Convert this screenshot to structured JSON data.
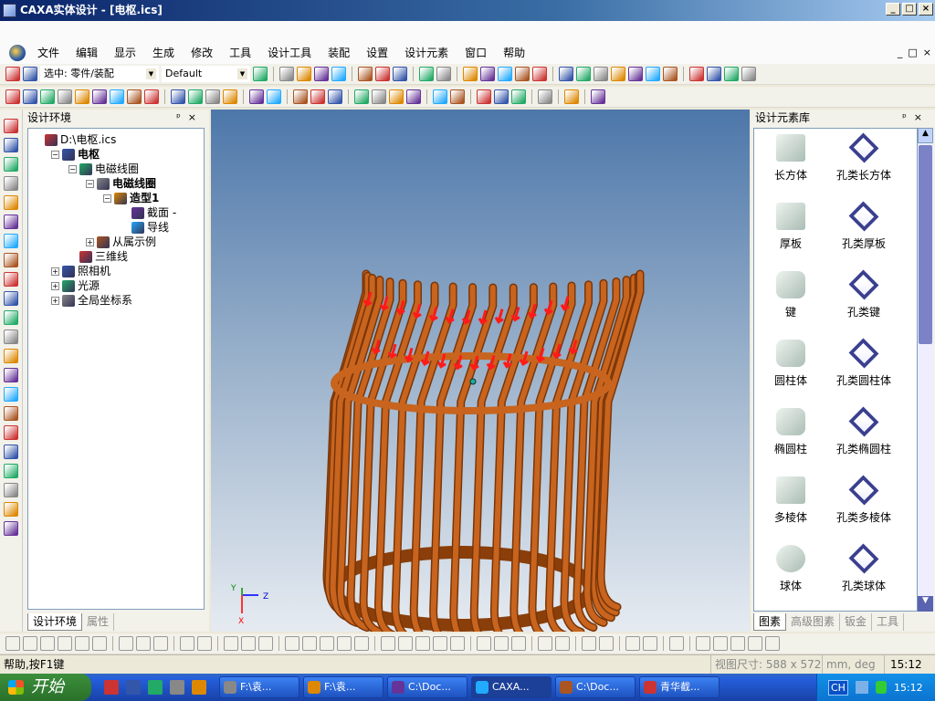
{
  "window": {
    "title": "CAXA实体设计 - [电枢.ics]",
    "minimize": "_",
    "maximize": "□",
    "close": "×"
  },
  "menu": [
    "文件",
    "编辑",
    "显示",
    "生成",
    "修改",
    "工具",
    "设计工具",
    "装配",
    "设置",
    "设计元素",
    "窗口",
    "帮助"
  ],
  "toolbar1": {
    "select_combo": "选中: 零件/装配",
    "style_combo": "Default",
    "icons": [
      "select-arrow-icon",
      "select-filter-icon",
      "assembly-tree-icon",
      "wireframe-box-icon",
      "wireframe-blue-icon",
      "smooth-shading-icon",
      "smooth-edge-shading-icon",
      "transparent-box-icon",
      "shaded-gray-icon",
      "shaded-gray2-icon",
      "properties-icon",
      "warning-icon",
      "extrude-icon",
      "revolve-icon",
      "sweep-icon",
      "loft-icon",
      "shell-icon",
      "fillet-icon",
      "chamfer-icon",
      "draft-icon",
      "split-icon",
      "mirror-icon",
      "pattern-icon",
      "boolean-icon",
      "red-cube-icon",
      "red-cube2-icon",
      "red-cube3-icon",
      "red-cube4-icon"
    ]
  },
  "toolbar2": {
    "icons": [
      "curve-arrow-icon",
      "sketch-icon",
      "plane-icon",
      "offset-plane-icon",
      "formula-icon",
      "constraint-icon",
      "trim-icon",
      "extend-icon",
      "surface-icon",
      "extrude-up-icon",
      "rotate-icon",
      "sweep-tool-icon",
      "mouse-icon",
      "text-icon",
      "render-icon",
      "light-icon",
      "material-icon",
      "toolbox-icon",
      "new-doc-icon",
      "new-drawing-icon",
      "open-folder-icon",
      "save-icon",
      "undo-icon",
      "redo-icon",
      "copy-icon",
      "paste-icon",
      "cut-icon",
      "tree-view-icon",
      "green-arrow-icon",
      "help-pointer-icon"
    ]
  },
  "left_tools": [
    "move-icon",
    "rotate-view-icon",
    "pan-icon",
    "walk-icon",
    "zoom-icon",
    "zoom-window-icon",
    "zoom-fit-icon",
    "target-icon",
    "insert-icon",
    "camera-icon",
    "camera2-icon",
    "camera3-icon",
    "eraser-icon",
    "view-front-icon",
    "view-side-icon",
    "view-top-icon",
    "view-iso-icon",
    "view-shaded-icon",
    "sphere-icon",
    "dimension-icon",
    "eyedropper-icon",
    "pen-icon"
  ],
  "design_env": {
    "title": "设计环境",
    "pin": "ᵖ",
    "close": "×",
    "tree": [
      {
        "label": "D:\\电枢.ics",
        "level": 0,
        "toggle": "",
        "bold": false,
        "icon": "design-file-icon"
      },
      {
        "label": "电枢",
        "level": 1,
        "toggle": "−",
        "bold": true,
        "icon": "design-icon"
      },
      {
        "label": "电磁线圈",
        "level": 2,
        "toggle": "−",
        "bold": false,
        "icon": "assembly-icon"
      },
      {
        "label": "电磁线圈",
        "level": 3,
        "toggle": "−",
        "bold": true,
        "icon": "part-icon"
      },
      {
        "label": "造型1",
        "level": 4,
        "toggle": "−",
        "bold": true,
        "icon": "feature-block-icon"
      },
      {
        "label": "截面 -",
        "level": 5,
        "toggle": "",
        "bold": false,
        "icon": "section-icon"
      },
      {
        "label": "导线",
        "level": 5,
        "toggle": "",
        "bold": false,
        "icon": "guide-curve-icon"
      },
      {
        "label": "从属示例",
        "level": 3,
        "toggle": "+",
        "bold": false,
        "icon": "instance-icon"
      },
      {
        "label": "三维线",
        "level": 2,
        "toggle": "",
        "bold": false,
        "icon": "3d-curve-icon"
      },
      {
        "label": "照相机",
        "level": 1,
        "toggle": "+",
        "bold": false,
        "icon": "camera-icon"
      },
      {
        "label": "光源",
        "level": 1,
        "toggle": "+",
        "bold": false,
        "icon": "light-source-icon"
      },
      {
        "label": "全局坐标系",
        "level": 1,
        "toggle": "+",
        "bold": false,
        "icon": "global-coords-icon"
      }
    ],
    "tabs": [
      {
        "label": "设计环境",
        "active": true
      },
      {
        "label": "属性",
        "active": false
      }
    ]
  },
  "viewport": {
    "axes": {
      "x": "X",
      "y": "Y",
      "z": "Z"
    },
    "model_color": "#c8641e",
    "arrow_color": "#ff1a1a"
  },
  "library": {
    "title": "设计元素库",
    "pin": "ᵖ",
    "close": "×",
    "items": [
      "长方体",
      "孔类长方体",
      "厚板",
      "孔类厚板",
      "键",
      "孔类键",
      "圆柱体",
      "孔类圆柱体",
      "椭圆柱",
      "孔类椭圆柱",
      "多棱体",
      "孔类多棱体",
      "球体",
      "孔类球体"
    ],
    "tabs": [
      {
        "label": "图素",
        "active": true
      },
      {
        "label": "高级图素",
        "active": false
      },
      {
        "label": "钣金",
        "active": false
      },
      {
        "label": "工具",
        "active": false
      }
    ]
  },
  "bottom_toolbar": {
    "icons": [
      "project-icon",
      "scale-icon",
      "circle-arc-icon",
      "hatch-icon",
      "offset-icon",
      "stamp-icon",
      "delete-x-icon",
      "extend-line-icon",
      "trim-x-icon",
      "fillet-curve-icon",
      "chamfer-curve-icon",
      "line-icon",
      "angle-line-icon",
      "tangent-line-icon",
      "constraint-dim-icon",
      "circle-pair-icon",
      "rectangle-icon",
      "diamond-icon",
      "hexagon-icon",
      "circle-center-icon",
      "circle-2pt-icon",
      "circle-3pt-icon",
      "circle-tangent-icon",
      "circle-tangent2-icon",
      "arc-icon",
      "arc2-icon",
      "arc3-icon",
      "ellipse-icon",
      "spiral-icon",
      "spline-icon",
      "spline2-icon",
      "corner-icon",
      "corner2-icon",
      "text-block-icon",
      "perpendicular-icon",
      "parallel-icon",
      "equal-icon",
      "horizontal-icon",
      "vertical-icon"
    ]
  },
  "status": {
    "help": "帮助,按F1键",
    "view_size": "视图尺寸: 588 x 572",
    "units": "mm, deg",
    "time": "15:12"
  },
  "taskbar": {
    "start": "开始",
    "quicklaunch": [
      "qq-icon",
      "shield-app-icon",
      "browser-icon",
      "folder-app-icon",
      "paint-icon"
    ],
    "tasks": [
      {
        "label": "F:\\袁...",
        "icon": "folder-icon",
        "active": false
      },
      {
        "label": "F:\\袁...",
        "icon": "browser-icon",
        "active": false
      },
      {
        "label": "C:\\Doc...",
        "icon": "browser-icon",
        "active": false
      },
      {
        "label": "CAXA...",
        "icon": "caxa-icon",
        "active": true
      },
      {
        "label": "C:\\Doc...",
        "icon": "globe-icon",
        "active": false
      },
      {
        "label": "青华截...",
        "icon": "winrar-icon",
        "active": false
      }
    ],
    "ime": "CH",
    "clock": "15:12"
  }
}
